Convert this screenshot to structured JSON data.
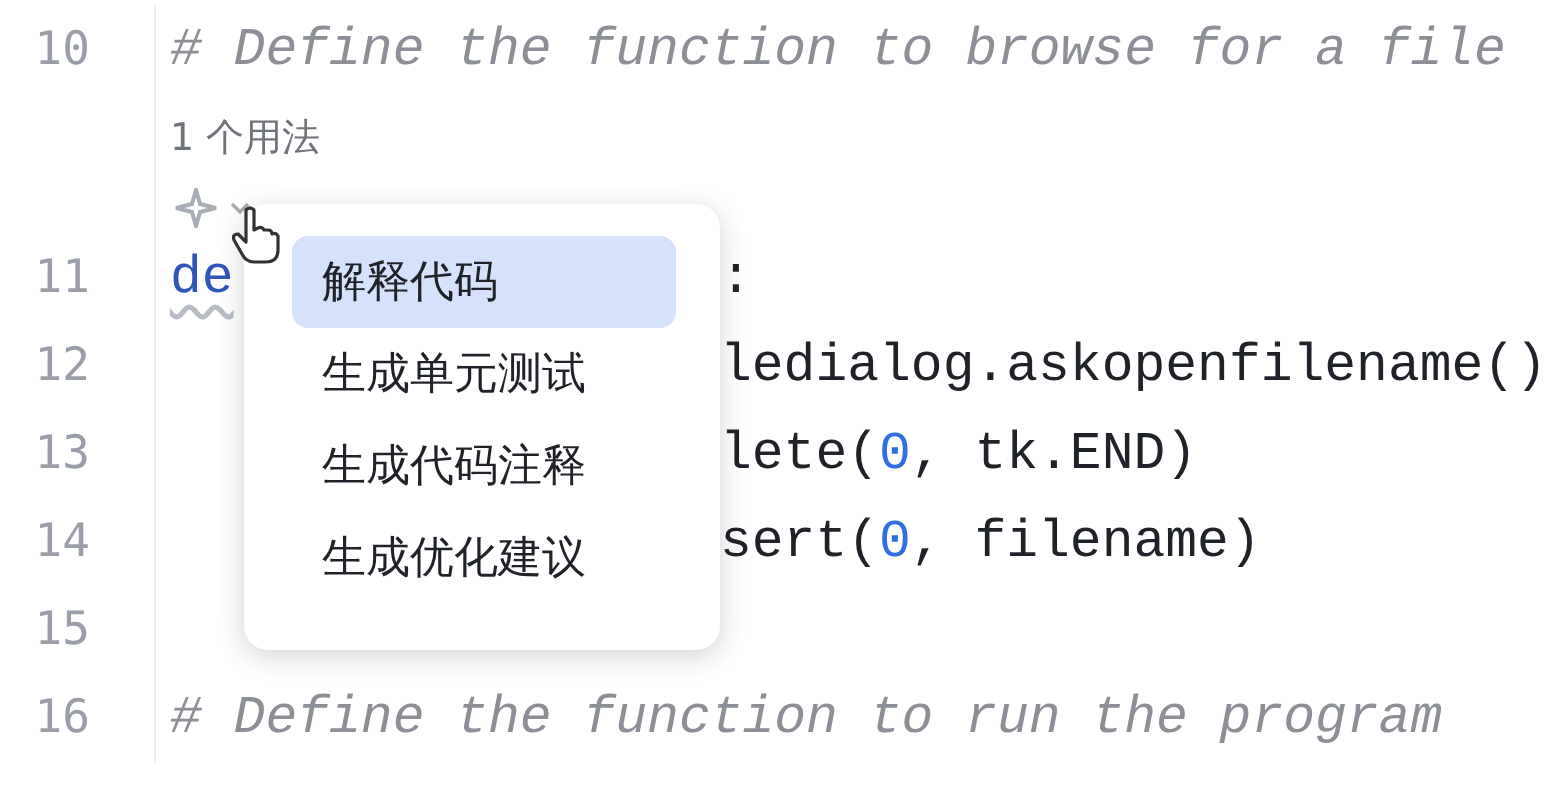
{
  "lines": [
    {
      "kind": "comment",
      "number": "10",
      "text": "# Define the function to browse for a file"
    },
    {
      "kind": "inlay",
      "text": "1 个用法"
    },
    {
      "kind": "actions"
    },
    {
      "kind": "code",
      "number": "11",
      "parts": [
        {
          "kind": "keyword",
          "text": "de"
        }
      ],
      "tail": [
        {
          "kind": "plain",
          "text": ":"
        }
      ]
    },
    {
      "kind": "code",
      "number": "12",
      "tail": [
        {
          "kind": "plain",
          "text": "ledialog.askopenfilename()"
        }
      ]
    },
    {
      "kind": "code",
      "number": "13",
      "tail": [
        {
          "kind": "plain",
          "text": "lete("
        },
        {
          "kind": "number",
          "text": "0"
        },
        {
          "kind": "plain",
          "text": ", tk.END)"
        }
      ]
    },
    {
      "kind": "code",
      "number": "14",
      "tail": [
        {
          "kind": "plain",
          "text": "sert("
        },
        {
          "kind": "number",
          "text": "0"
        },
        {
          "kind": "plain",
          "text": ", filename)"
        }
      ]
    },
    {
      "kind": "code",
      "number": "15"
    },
    {
      "kind": "comment",
      "number": "16",
      "text": "# Define the function to run the program"
    }
  ],
  "menu": [
    {
      "label": "解释代码",
      "selected": true
    },
    {
      "label": "生成单元测试",
      "selected": false
    },
    {
      "label": "生成代码注释",
      "selected": false
    },
    {
      "label": "生成优化建议",
      "selected": false
    }
  ]
}
